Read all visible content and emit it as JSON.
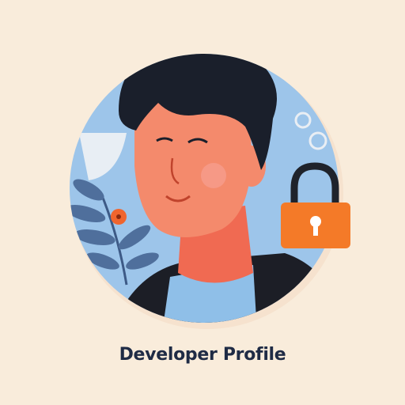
{
  "caption": "Developer Profile",
  "colors": {
    "background": "#f9ecdb",
    "circle": "#9dc5ea",
    "skin": "#f48a6c",
    "hair": "#1a1f2b",
    "jacket": "#1c1e26",
    "shirt": "#8fbfe8",
    "lock": "#f47a28",
    "leaves": "#4f6f9c",
    "flower": "#f0652e",
    "text": "#1f2b45"
  },
  "icons": [
    "lock-icon",
    "gear-icon",
    "plant-icon"
  ]
}
